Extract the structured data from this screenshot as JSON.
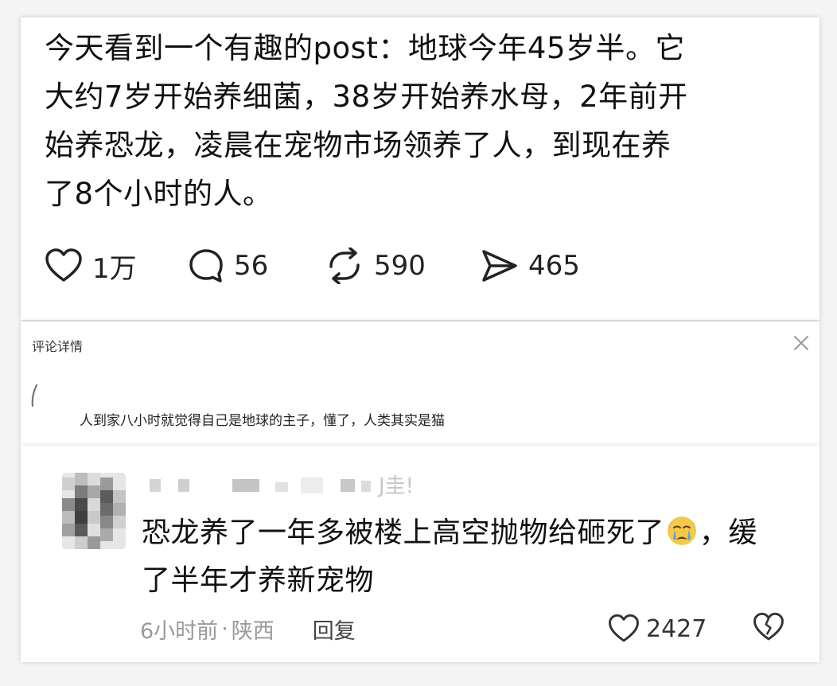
{
  "post": {
    "lines": [
      "今天看到一个有趣的post：地球今年45岁半。它",
      "大约7岁开始养细菌，38岁开始养水母，2年前开",
      "始养恐龙，凌晨在宠物市场领养了人，到现在养",
      "了8个小时的人。"
    ],
    "actions": {
      "likes": "1万",
      "comments": "56",
      "reposts": "590",
      "shares": "465"
    }
  },
  "detail": {
    "title": "评论详情",
    "comment": "人到家八小时就觉得自己是地球的主子，懂了，人类其实是猫"
  },
  "reply": {
    "username_suffix": "J圭!",
    "text_line1_a": "恐龙养了一年多被楼上高空抛物给砸死了",
    "emoji": "crying-face-emoji",
    "text_line1_b": "，缓",
    "text_line2": "了半年才养新宠物",
    "time": "6小时前",
    "location": "陕西",
    "meta_sep": "·",
    "reply_label": "回复",
    "likes": "2427"
  },
  "colors": {
    "text": "#111111",
    "muted": "#9a9a9a",
    "card": "#ffffff",
    "background": "#f4f4f4"
  }
}
